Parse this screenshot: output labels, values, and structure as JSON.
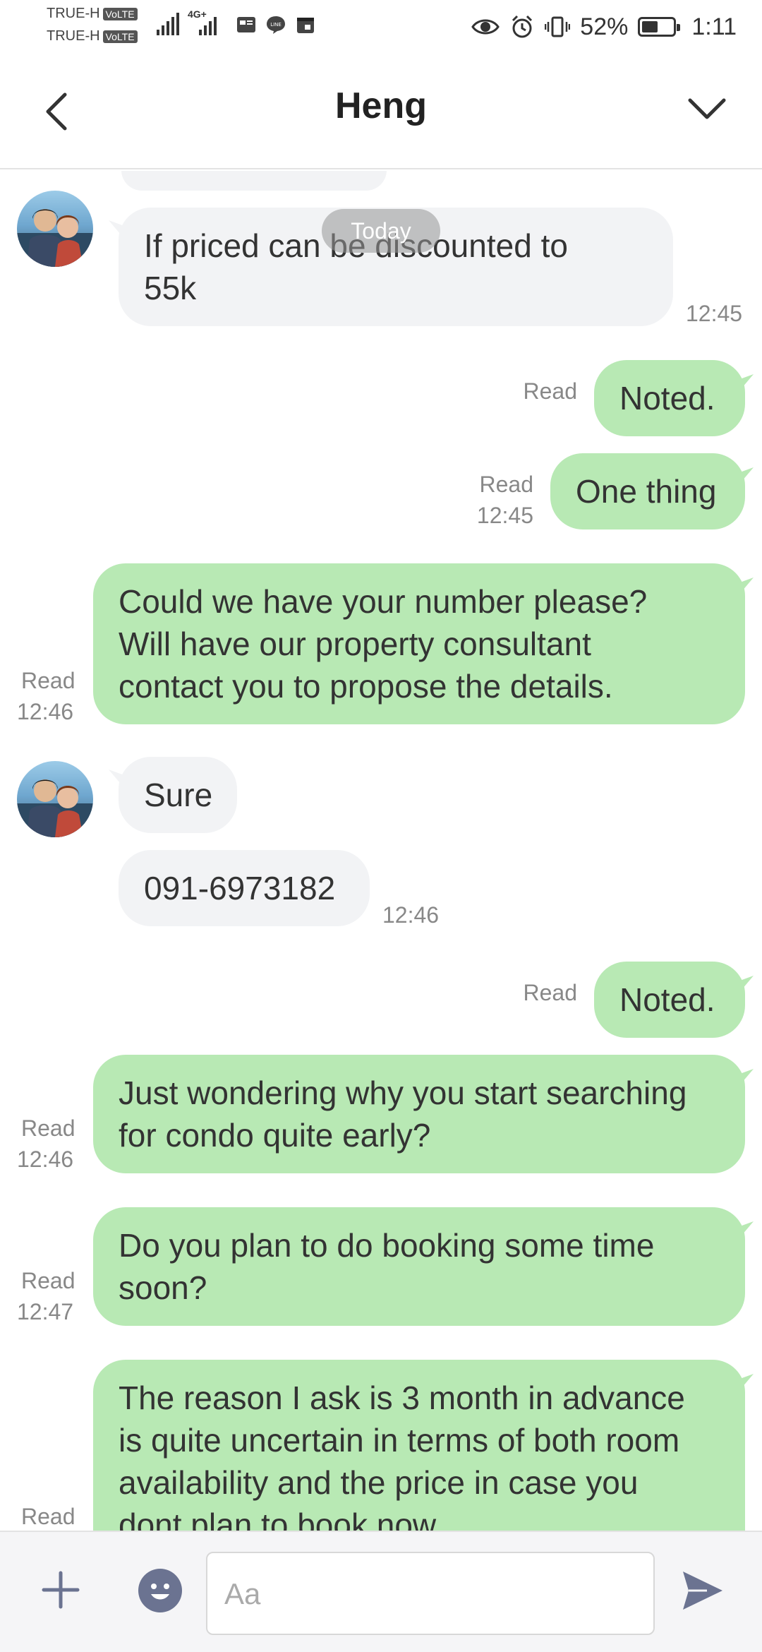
{
  "status_bar": {
    "carrier1": "TRUE-H",
    "carrier2": "TRUE-H",
    "volte": "VoLTE",
    "net_type": "4G+",
    "battery_percent": "52%",
    "battery_level": 0.52,
    "time": "1:11"
  },
  "header": {
    "title": "Heng"
  },
  "chat": {
    "date_divider": "Today",
    "messages": [
      {
        "side": "in",
        "text1": "If priced can be discounted to",
        "text2": "55k",
        "time": "12:45"
      },
      {
        "side": "out",
        "text": "Noted.",
        "status": "Read"
      },
      {
        "side": "out",
        "text": "One thing",
        "status": "Read",
        "time": "12:45"
      },
      {
        "side": "out",
        "lines": [
          "Could we have your number please?",
          "Will have our property consultant",
          "contact you to propose the details."
        ],
        "status": "Read",
        "time": "12:46"
      },
      {
        "side": "in",
        "text": "Sure"
      },
      {
        "side": "in",
        "text": "091-6973182",
        "time": "12:46"
      },
      {
        "side": "out",
        "text": "Noted.",
        "status": "Read"
      },
      {
        "side": "out",
        "lines": [
          "Just wondering why you start searching",
          "for condo quite early?"
        ],
        "status": "Read",
        "time": "12:46"
      },
      {
        "side": "out",
        "lines": [
          "Do you plan to do booking some time",
          "soon?"
        ],
        "status": "Read",
        "time": "12:47"
      },
      {
        "side": "out",
        "lines": [
          "The reason I ask is 3 month in advance",
          "is quite uncertain in terms of both room",
          "availability and the price in case you",
          "dont plan to book now"
        ],
        "status": "Read"
      }
    ]
  },
  "input": {
    "placeholder": "Aa"
  },
  "colors": {
    "outgoing_bubble": "#b8e9b4",
    "incoming_bubble": "#f2f3f5",
    "icon": "#6b7391"
  }
}
